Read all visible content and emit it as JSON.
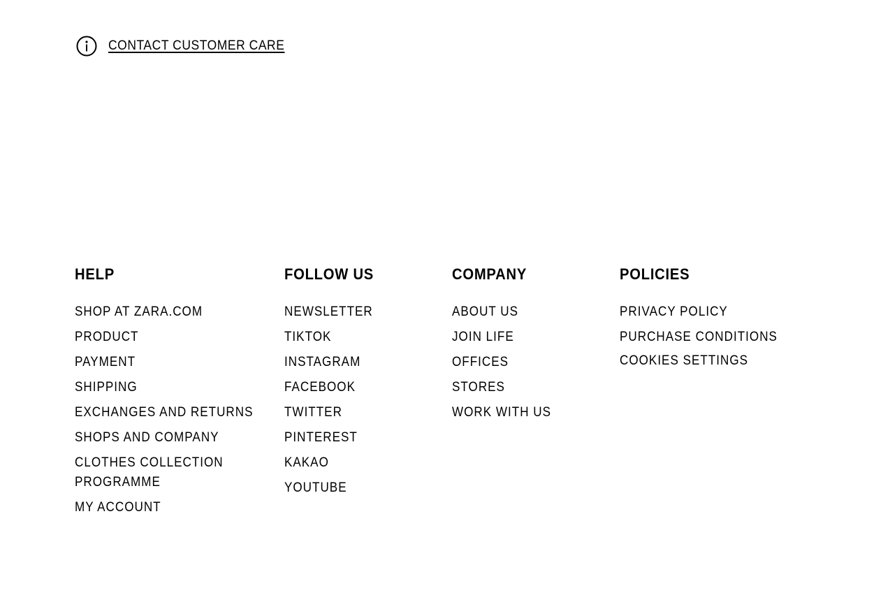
{
  "contact": {
    "icon": "info-icon",
    "label": "CONTACT CUSTOMER CARE"
  },
  "footer": {
    "help": {
      "title": "HELP",
      "items": [
        "SHOP AT ZARA.COM",
        "PRODUCT",
        "PAYMENT",
        "SHIPPING",
        "EXCHANGES AND RETURNS",
        "SHOPS AND COMPANY",
        "CLOTHES COLLECTION PROGRAMME",
        "MY ACCOUNT"
      ]
    },
    "follow": {
      "title": "FOLLOW US",
      "items": [
        "NEWSLETTER",
        "TIKTOK",
        "INSTAGRAM",
        "FACEBOOK",
        "TWITTER",
        "PINTEREST",
        "KAKAO",
        "YOUTUBE"
      ]
    },
    "company": {
      "title": "COMPANY",
      "items": [
        "ABOUT US",
        "JOIN LIFE",
        "OFFICES",
        "STORES",
        "WORK WITH US"
      ]
    },
    "policies": {
      "title": "POLICIES",
      "items": [
        "PRIVACY POLICY",
        "PURCHASE CONDITIONS",
        "COOKIES SETTINGS"
      ]
    }
  }
}
